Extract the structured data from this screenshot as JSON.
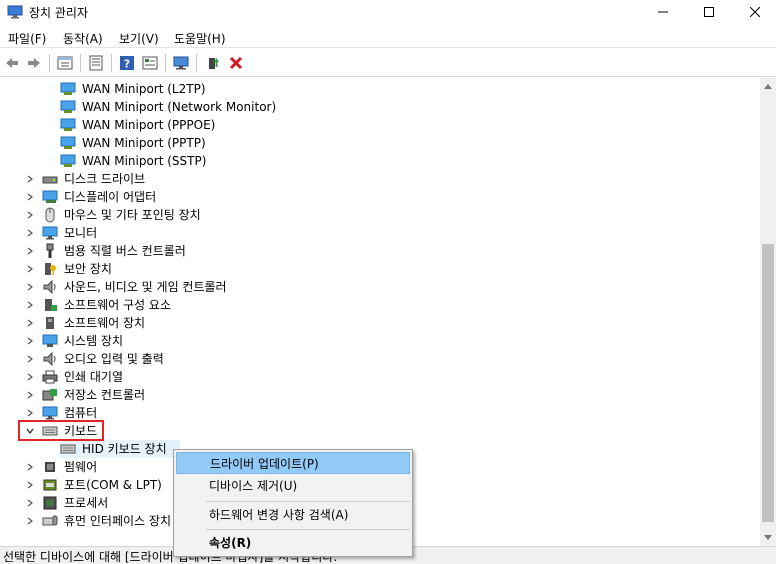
{
  "window": {
    "title": "장치 관리자"
  },
  "menu": [
    {
      "label": "파일(F)"
    },
    {
      "label": "동작(A)"
    },
    {
      "label": "보기(V)"
    },
    {
      "label": "도움말(H)"
    }
  ],
  "toolbar": {
    "icons": [
      "back-arrow-icon",
      "forward-arrow-icon",
      "properties-sheet-icon",
      "device-list-icon",
      "help-icon",
      "update-driver-icon",
      "monitor-scan-icon",
      "enable-device-icon",
      "uninstall-x-icon"
    ]
  },
  "tree": {
    "wan_items": [
      "WAN Miniport (L2TP)",
      "WAN Miniport (Network Monitor)",
      "WAN Miniport (PPPOE)",
      "WAN Miniport (PPTP)",
      "WAN Miniport (SSTP)"
    ],
    "categories_before": [
      {
        "label": "디스크 드라이브",
        "icon": "disk-drive-icon"
      },
      {
        "label": "디스플레이 어댑터",
        "icon": "display-adapter-icon"
      },
      {
        "label": "마우스 및 기타 포인팅 장치",
        "icon": "mouse-icon"
      },
      {
        "label": "모니터",
        "icon": "monitor-icon"
      },
      {
        "label": "범용 직렬 버스 컨트롤러",
        "icon": "usb-icon"
      },
      {
        "label": "보안 장치",
        "icon": "security-key-icon"
      },
      {
        "label": "사운드, 비디오 및 게임 컨트롤러",
        "icon": "speaker-icon"
      },
      {
        "label": "소프트웨어 구성 요소",
        "icon": "software-component-icon"
      },
      {
        "label": "소프트웨어 장치",
        "icon": "software-device-icon"
      },
      {
        "label": "시스템 장치",
        "icon": "system-device-icon"
      },
      {
        "label": "오디오 입력 및 출력",
        "icon": "audio-icon"
      },
      {
        "label": "인쇄 대기열",
        "icon": "printer-icon"
      },
      {
        "label": "저장소 컨트롤러",
        "icon": "storage-controller-icon"
      },
      {
        "label": "컴퓨터",
        "icon": "computer-icon"
      }
    ],
    "keyboard": {
      "label": "키보드",
      "child": "HID 키보드 장치"
    },
    "categories_after": [
      {
        "label": "펌웨어",
        "icon": "firmware-icon"
      },
      {
        "label": "포트(COM & LPT)",
        "icon": "port-icon"
      },
      {
        "label": "프로세서",
        "icon": "processor-icon"
      },
      {
        "label": "휴먼 인터페이스 장치",
        "icon": "hid-icon"
      }
    ]
  },
  "context_menu": {
    "update_driver": "드라이버 업데이트(P)",
    "uninstall": "디바이스 제거(U)",
    "scan": "하드웨어 변경 사항 검색(A)",
    "properties": "속성(R)"
  },
  "status": {
    "text": "선택한 디바이스에 대해 [드라이버 업데이트 마법사]를 시작합니다."
  },
  "colors": {
    "highlight_border": "#e0262b",
    "menu_hover": "#91c9f7"
  }
}
